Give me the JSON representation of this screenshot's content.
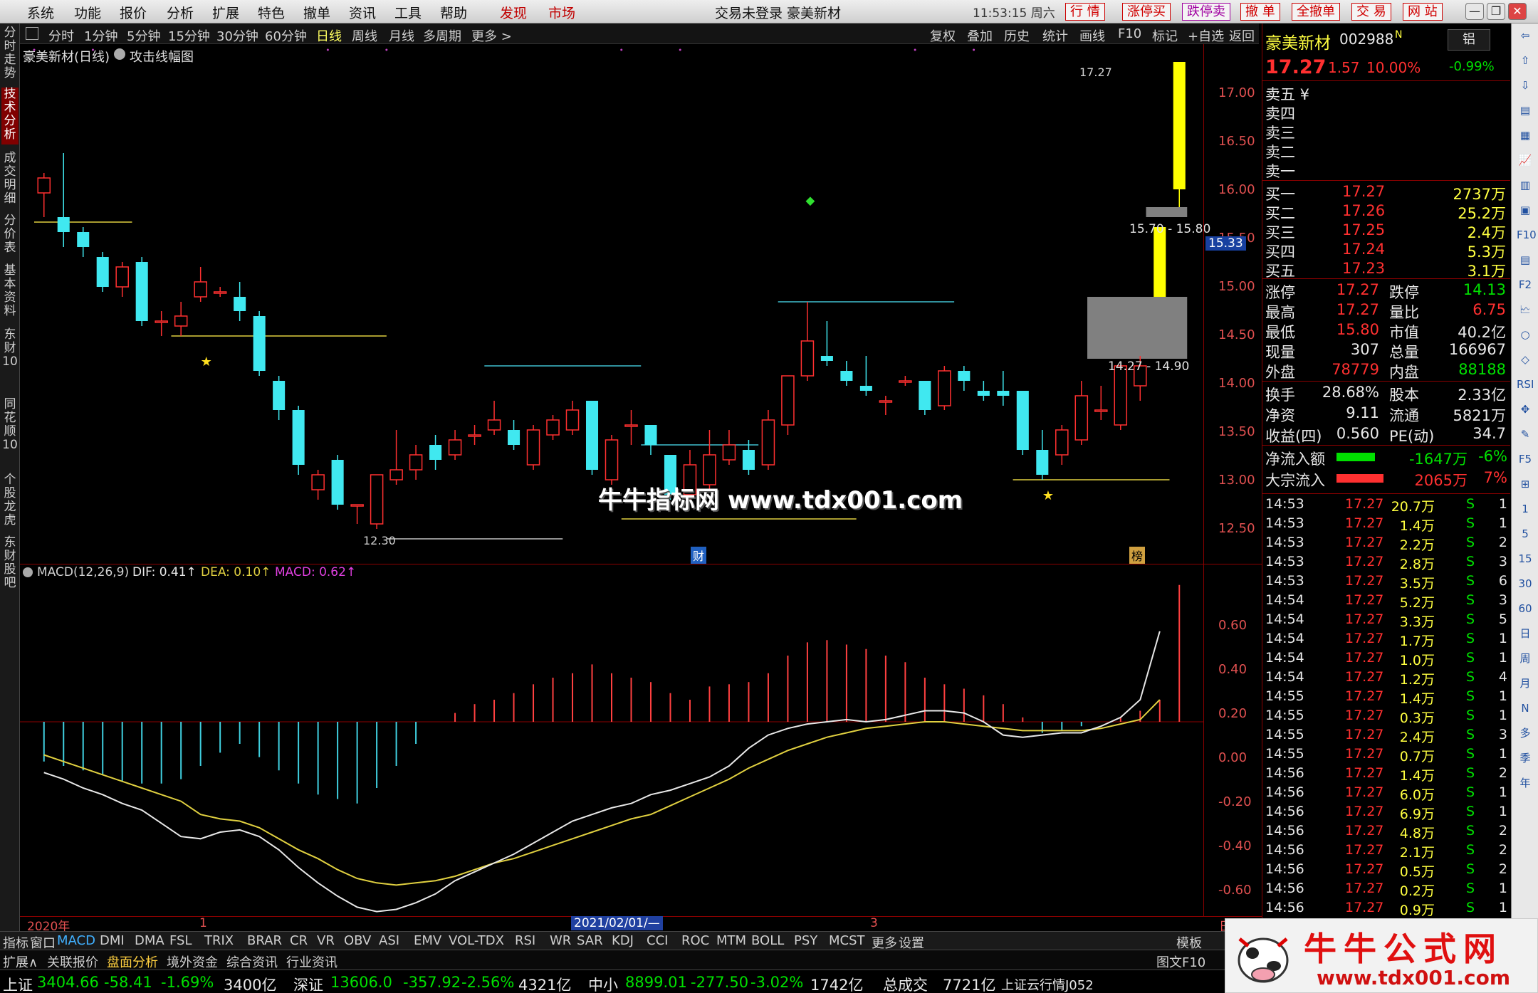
{
  "menu": {
    "items": [
      "系统",
      "功能",
      "报价",
      "分析",
      "扩展",
      "特色",
      "撤单",
      "资讯",
      "工具",
      "帮助"
    ],
    "discover": "发现",
    "market": "市场",
    "status": "交易未登录  豪美新材",
    "time": "11:53:15 周六",
    "buttons": [
      "行 情",
      "涨停买",
      "跌停卖",
      "撤 单",
      "全撤单",
      "交 易",
      "网 站"
    ],
    "win_min": "—",
    "win_restore": "❐",
    "win_close": "✕"
  },
  "period_bar": {
    "items": [
      "分时",
      "1分钟",
      "5分钟",
      "15分钟",
      "30分钟",
      "60分钟",
      "日线",
      "周线",
      "月线",
      "多周期",
      "更多 >"
    ],
    "active": "日线",
    "right_items": [
      "复权",
      "叠加",
      "历史",
      "统计",
      "画线",
      "F10",
      "标记",
      "+自选",
      "返回"
    ]
  },
  "left_tabs": [
    "分时走势",
    "技术分析",
    "成交明细",
    "分价表",
    "基本资料",
    "东财10",
    "同花顺10",
    "个股龙虎",
    "东财股吧"
  ],
  "left_tab_active": "技术分析",
  "chart": {
    "title": "豪美新材(日线)",
    "indicator_name": "攻击线幅图",
    "y_labels": [
      "17.00",
      "16.50",
      "16.00",
      "15.50",
      "15.00",
      "14.50",
      "14.00",
      "13.50",
      "13.00",
      "12.50"
    ],
    "current_price_tag": "15.33",
    "annotation_high": "17.27",
    "annotation_low": "12.30",
    "gap_upper": "15.70 - 15.80",
    "gap_lower": "14.27 - 14.90",
    "marker_cai": "财",
    "marker_bang": "榜",
    "watermark": "牛牛指标网 www.tdx001.com"
  },
  "macd": {
    "label": "MACD(12,26,9)",
    "dif": "DIF: 0.41↑",
    "dea": "DEA: 0.10↑",
    "macd": "MACD: 0.62↑",
    "y_labels": [
      "0.60",
      "0.40",
      "0.20",
      "0.00",
      "-0.20",
      "-0.40",
      "-0.60"
    ]
  },
  "x_axis": {
    "start": "2020年",
    "mark1": "1",
    "date_highlight": "2021/02/01/—",
    "mark3": "3",
    "right_mark": "日"
  },
  "quote": {
    "name": "豪美新材",
    "code": "002988",
    "code_suffix": "N",
    "badge": "铝",
    "price": "17.27",
    "change": "1.57",
    "pct": "10.00%",
    "side_pct": "-0.99%",
    "sells": [
      "卖五 ¥",
      "卖四",
      "卖三",
      "卖二",
      "卖一"
    ],
    "buys": [
      {
        "label": "买一",
        "price": "17.27",
        "vol": "2737万"
      },
      {
        "label": "买二",
        "price": "17.26",
        "vol": "25.2万"
      },
      {
        "label": "买三",
        "price": "17.25",
        "vol": "2.4万"
      },
      {
        "label": "买四",
        "price": "17.24",
        "vol": "5.3万"
      },
      {
        "label": "买五",
        "price": "17.23",
        "vol": "3.1万"
      }
    ],
    "stats": [
      {
        "l1": "涨停",
        "v1": "17.27",
        "l2": "跌停",
        "v2": "14.13",
        "c1": "up",
        "c2": "dn"
      },
      {
        "l1": "最高",
        "v1": "17.27",
        "l2": "量比",
        "v2": "6.75",
        "c1": "up",
        "c2": "up"
      },
      {
        "l1": "最低",
        "v1": "15.80",
        "l2": "市值",
        "v2": "40.2亿",
        "c1": "up",
        "c2": "wt"
      },
      {
        "l1": "现量",
        "v1": "307",
        "l2": "总量",
        "v2": "166967",
        "c1": "wt",
        "c2": "wt"
      },
      {
        "l1": "外盘",
        "v1": "78779",
        "l2": "内盘",
        "v2": "88188",
        "c1": "up",
        "c2": "dn"
      }
    ],
    "stats2": [
      {
        "l1": "换手",
        "v1": "28.68%",
        "l2": "股本",
        "v2": "2.33亿"
      },
      {
        "l1": "净资",
        "v1": "9.11",
        "l2": "流通",
        "v2": "5821万"
      },
      {
        "l1": "收益(四)",
        "v1": "0.560",
        "l2": "PE(动)",
        "v2": "34.7"
      }
    ],
    "flow": [
      {
        "label": "净流入额",
        "value": "-1647万",
        "pct": "-6%",
        "fill": 0.6,
        "color": "#00e000"
      },
      {
        "label": "大宗流入",
        "value": "2065万",
        "pct": "7%",
        "fill": 0.73,
        "color": "#ff3030"
      }
    ],
    "ticks": [
      {
        "t": "14:53",
        "p": "17.27",
        "v": "20.7万",
        "s": "S",
        "n": "1"
      },
      {
        "t": "14:53",
        "p": "17.27",
        "v": "1.4万",
        "s": "S",
        "n": "1"
      },
      {
        "t": "14:53",
        "p": "17.27",
        "v": "2.2万",
        "s": "S",
        "n": "2"
      },
      {
        "t": "14:53",
        "p": "17.27",
        "v": "2.8万",
        "s": "S",
        "n": "3"
      },
      {
        "t": "14:53",
        "p": "17.27",
        "v": "3.5万",
        "s": "S",
        "n": "6"
      },
      {
        "t": "14:54",
        "p": "17.27",
        "v": "5.2万",
        "s": "S",
        "n": "3"
      },
      {
        "t": "14:54",
        "p": "17.27",
        "v": "3.3万",
        "s": "S",
        "n": "5"
      },
      {
        "t": "14:54",
        "p": "17.27",
        "v": "1.7万",
        "s": "S",
        "n": "1"
      },
      {
        "t": "14:54",
        "p": "17.27",
        "v": "1.0万",
        "s": "S",
        "n": "1"
      },
      {
        "t": "14:54",
        "p": "17.27",
        "v": "1.2万",
        "s": "S",
        "n": "4"
      },
      {
        "t": "14:55",
        "p": "17.27",
        "v": "1.4万",
        "s": "S",
        "n": "1"
      },
      {
        "t": "14:55",
        "p": "17.27",
        "v": "0.3万",
        "s": "S",
        "n": "1"
      },
      {
        "t": "14:55",
        "p": "17.27",
        "v": "2.4万",
        "s": "S",
        "n": "3"
      },
      {
        "t": "14:55",
        "p": "17.27",
        "v": "0.7万",
        "s": "S",
        "n": "1"
      },
      {
        "t": "14:56",
        "p": "17.27",
        "v": "1.4万",
        "s": "S",
        "n": "2"
      },
      {
        "t": "14:56",
        "p": "17.27",
        "v": "6.0万",
        "s": "S",
        "n": "1"
      },
      {
        "t": "14:56",
        "p": "17.27",
        "v": "6.9万",
        "s": "S",
        "n": "1"
      },
      {
        "t": "14:56",
        "p": "17.27",
        "v": "4.8万",
        "s": "S",
        "n": "2"
      },
      {
        "t": "14:56",
        "p": "17.27",
        "v": "2.1万",
        "s": "S",
        "n": "2"
      },
      {
        "t": "14:56",
        "p": "17.27",
        "v": "0.5万",
        "s": "S",
        "n": "2"
      },
      {
        "t": "14:56",
        "p": "17.27",
        "v": "0.2万",
        "s": "S",
        "n": "1"
      },
      {
        "t": "14:56",
        "p": "17.27",
        "v": "0.9万",
        "s": "S",
        "n": "1"
      }
    ]
  },
  "right_icons": [
    "⇦",
    "⇧",
    "⇩",
    "▤",
    "▦",
    "📈",
    "▥",
    "▣",
    "F10",
    "▤",
    "F2",
    "🗠",
    "○",
    "◇",
    "RSI",
    "✥",
    "✎",
    "F5",
    "⊞",
    "1",
    "5",
    "15",
    "30",
    "60",
    "日",
    "周",
    "月",
    "N",
    "多",
    "季",
    "年"
  ],
  "indicators": [
    "指标",
    "窗口",
    "MACD",
    "DMI",
    "DMA",
    "FSL",
    "TRIX",
    "BRAR",
    "CR",
    "VR",
    "OBV",
    "ASI",
    "EMV",
    "VOL-TDX",
    "RSI",
    "WR",
    "SAR",
    "KDJ",
    "CCI",
    "ROC",
    "MTM",
    "BOLL",
    "PSY",
    "MCST",
    "更多",
    "设置"
  ],
  "indicator_active": "MACD",
  "indicator_right": "模板",
  "sub_tabs": [
    "扩展∧",
    "关联报价",
    "盘面分析",
    "境外资金",
    "综合资讯",
    "行业资讯"
  ],
  "sub_tabs_right": "图文F10",
  "ticker": [
    {
      "label": "上证",
      "price": "3404.66",
      "chg": "-58.41",
      "pct": "-1.69%",
      "amt": "3400亿"
    },
    {
      "label": "深证",
      "price": "13606.0",
      "chg": "-357.92",
      "pct": "-2.56%",
      "amt": "4321亿"
    },
    {
      "label": "中小",
      "price": "8899.01",
      "chg": "-277.50",
      "pct": "-3.02%",
      "amt": "1742亿"
    }
  ],
  "ticker_total_label": "总成交",
  "ticker_total": "7721亿",
  "ticker_news": "上证云行情J052",
  "logo": {
    "title": "牛牛公式网",
    "url": "www.tdx001.com"
  },
  "chart_data": {
    "type": "candlestick",
    "ylim": [
      12.2,
      17.45
    ],
    "candles": [
      [
        15.95,
        16.1,
        15.7,
        16.15
      ],
      [
        15.7,
        15.55,
        15.4,
        16.35
      ],
      [
        15.55,
        15.4,
        15.3,
        15.6
      ],
      [
        15.3,
        15.0,
        14.95,
        15.35
      ],
      [
        15.0,
        15.2,
        14.9,
        15.25
      ],
      [
        15.25,
        14.65,
        14.6,
        15.3
      ],
      [
        14.65,
        14.65,
        14.5,
        14.75
      ],
      [
        14.6,
        14.7,
        14.5,
        14.85
      ],
      [
        14.9,
        15.05,
        14.85,
        15.2
      ],
      [
        14.95,
        14.95,
        14.9,
        15.0
      ],
      [
        14.9,
        14.75,
        14.65,
        15.05
      ],
      [
        14.7,
        14.15,
        14.1,
        14.75
      ],
      [
        14.05,
        13.75,
        13.65,
        14.1
      ],
      [
        13.75,
        13.2,
        13.1,
        13.8
      ],
      [
        12.95,
        13.1,
        12.85,
        13.15
      ],
      [
        13.25,
        12.8,
        12.75,
        13.3
      ],
      [
        12.8,
        12.8,
        12.6,
        12.8
      ],
      [
        12.6,
        13.1,
        12.55,
        13.1
      ],
      [
        13.05,
        13.15,
        13.0,
        13.55
      ],
      [
        13.15,
        13.3,
        13.05,
        13.4
      ],
      [
        13.4,
        13.25,
        13.15,
        13.5
      ],
      [
        13.3,
        13.45,
        13.25,
        13.55
      ],
      [
        13.5,
        13.5,
        13.4,
        13.6
      ],
      [
        13.55,
        13.65,
        13.5,
        13.85
      ],
      [
        13.55,
        13.4,
        13.35,
        13.65
      ],
      [
        13.2,
        13.55,
        13.15,
        13.6
      ],
      [
        13.5,
        13.65,
        13.45,
        13.7
      ],
      [
        13.55,
        13.75,
        13.5,
        13.85
      ],
      [
        13.85,
        13.15,
        13.1,
        13.85
      ],
      [
        13.05,
        13.45,
        13.0,
        13.5
      ],
      [
        13.6,
        13.6,
        13.4,
        13.75
      ],
      [
        13.6,
        13.4,
        13.3,
        13.6
      ],
      [
        13.3,
        12.9,
        12.85,
        13.3
      ],
      [
        12.9,
        13.2,
        12.85,
        13.35
      ],
      [
        13.0,
        13.3,
        12.95,
        13.55
      ],
      [
        13.25,
        13.4,
        13.2,
        13.55
      ],
      [
        13.35,
        13.15,
        13.1,
        13.45
      ],
      [
        13.2,
        13.65,
        13.15,
        13.75
      ],
      [
        13.6,
        14.1,
        13.5,
        14.1
      ],
      [
        14.1,
        14.45,
        14.05,
        14.85
      ],
      [
        14.3,
        14.25,
        14.2,
        14.65
      ],
      [
        14.15,
        14.05,
        14.0,
        14.25
      ],
      [
        14.0,
        13.95,
        13.9,
        14.3
      ],
      [
        13.85,
        13.85,
        13.7,
        13.9
      ],
      [
        14.05,
        14.05,
        14.0,
        14.1
      ],
      [
        14.05,
        13.75,
        13.7,
        14.05
      ],
      [
        13.8,
        14.15,
        13.75,
        14.2
      ],
      [
        14.15,
        14.05,
        13.95,
        14.2
      ],
      [
        13.95,
        13.9,
        13.85,
        14.05
      ],
      [
        13.95,
        13.9,
        13.8,
        14.15
      ],
      [
        13.95,
        13.35,
        13.3,
        13.95
      ],
      [
        13.35,
        13.1,
        13.05,
        13.55
      ],
      [
        13.3,
        13.55,
        13.2,
        13.6
      ],
      [
        13.45,
        13.9,
        13.4,
        14.05
      ],
      [
        13.75,
        13.75,
        13.65,
        14.0
      ],
      [
        13.6,
        14.2,
        13.55,
        14.2
      ],
      [
        14.0,
        14.2,
        13.85,
        14.3
      ],
      [
        14.9,
        15.6,
        14.9,
        15.6
      ],
      [
        15.98,
        17.27,
        15.8,
        17.27
      ]
    ],
    "macd_hist": [
      -0.18,
      -0.2,
      -0.22,
      -0.24,
      -0.27,
      -0.28,
      -0.28,
      -0.26,
      -0.2,
      -0.14,
      -0.1,
      -0.16,
      -0.22,
      -0.28,
      -0.33,
      -0.35,
      -0.37,
      -0.3,
      -0.2,
      -0.1,
      0.0,
      0.04,
      0.08,
      0.1,
      0.13,
      0.17,
      0.2,
      0.22,
      0.26,
      0.22,
      0.2,
      0.18,
      0.13,
      0.1,
      0.16,
      0.17,
      0.18,
      0.22,
      0.3,
      0.36,
      0.37,
      0.35,
      0.33,
      0.3,
      0.27,
      0.2,
      0.17,
      0.15,
      0.12,
      0.08,
      0.02,
      -0.05,
      -0.04,
      -0.02,
      0.0,
      0.02,
      0.05,
      0.1,
      0.62
    ],
    "dif": [
      -0.23,
      -0.26,
      -0.3,
      -0.33,
      -0.37,
      -0.4,
      -0.46,
      -0.52,
      -0.53,
      -0.5,
      -0.49,
      -0.52,
      -0.58,
      -0.66,
      -0.73,
      -0.79,
      -0.84,
      -0.86,
      -0.85,
      -0.82,
      -0.78,
      -0.72,
      -0.68,
      -0.64,
      -0.6,
      -0.55,
      -0.5,
      -0.45,
      -0.42,
      -0.39,
      -0.37,
      -0.33,
      -0.31,
      -0.28,
      -0.25,
      -0.2,
      -0.12,
      -0.06,
      -0.03,
      -0.01,
      0.0,
      0.01,
      0.0,
      0.01,
      0.03,
      0.05,
      0.05,
      0.04,
      0.0,
      -0.06,
      -0.07,
      -0.06,
      -0.05,
      -0.05,
      -0.02,
      0.02,
      0.1,
      0.41
    ],
    "dea": [
      -0.15,
      -0.18,
      -0.21,
      -0.24,
      -0.27,
      -0.3,
      -0.33,
      -0.36,
      -0.42,
      -0.44,
      -0.45,
      -0.48,
      -0.53,
      -0.58,
      -0.62,
      -0.67,
      -0.71,
      -0.73,
      -0.74,
      -0.73,
      -0.72,
      -0.7,
      -0.67,
      -0.64,
      -0.62,
      -0.59,
      -0.56,
      -0.53,
      -0.5,
      -0.47,
      -0.44,
      -0.42,
      -0.38,
      -0.34,
      -0.3,
      -0.26,
      -0.21,
      -0.17,
      -0.13,
      -0.1,
      -0.07,
      -0.05,
      -0.03,
      -0.02,
      -0.01,
      0.0,
      0.0,
      -0.01,
      -0.02,
      -0.03,
      -0.04,
      -0.04,
      -0.04,
      -0.04,
      -0.03,
      -0.01,
      0.01,
      0.1
    ]
  }
}
